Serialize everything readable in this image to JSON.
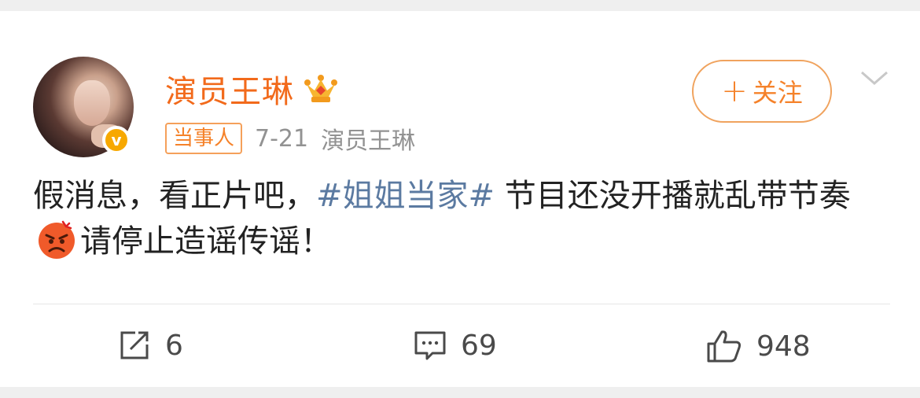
{
  "post": {
    "author_name": "演员王琳",
    "crown_icon": "crown-icon",
    "badge_label": "当事人",
    "date": "7-21",
    "source": "演员王琳",
    "follow_label": "关注",
    "follow_plus": "+",
    "more_icon": "chevron-down-icon",
    "text_part1": "假消息，看正片吧，",
    "hashtag": "#姐姐当家#",
    "text_part2": " 节目还没开播就乱带节奏",
    "emoji": "angry-face-emoji",
    "text_part3": "请停止造谣传谣！"
  },
  "actions": {
    "repost_count": "6",
    "comment_count": "69",
    "like_count": "948"
  },
  "colors": {
    "name": "#f26a1b",
    "follow_border": "#f0a35e",
    "hashtag": "#5b7aa1",
    "verified": "#f7a800"
  }
}
